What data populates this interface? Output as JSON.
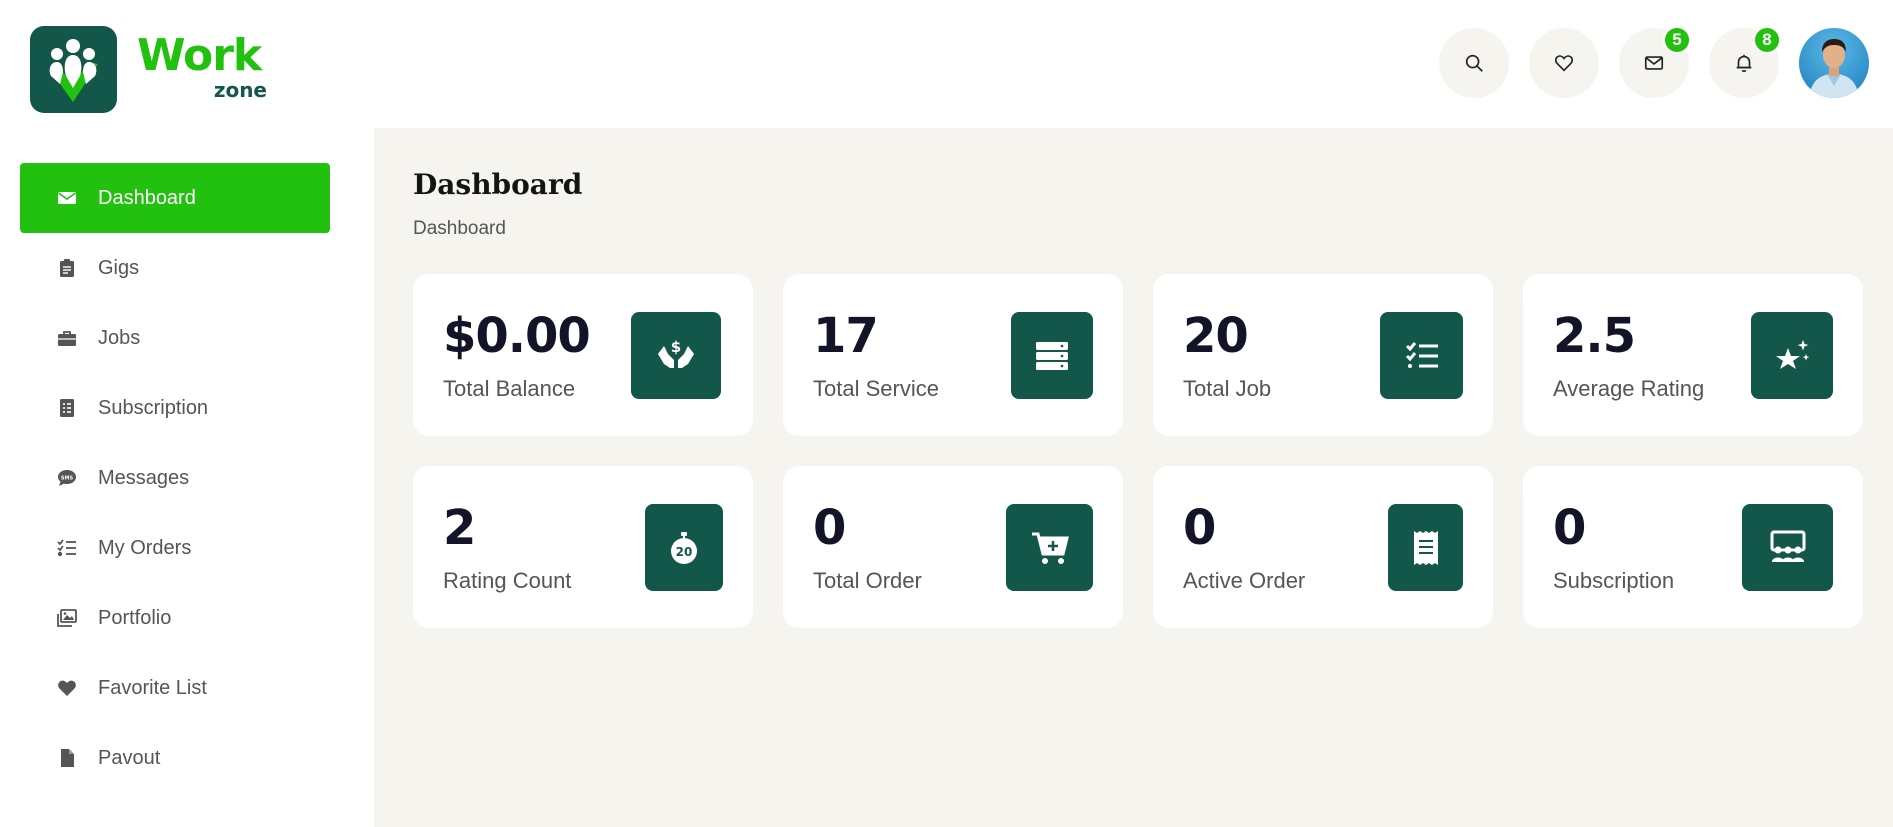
{
  "brand": {
    "word": "Work",
    "sub": "zone"
  },
  "header": {
    "badges": {
      "messages": "5",
      "notifications": "8"
    }
  },
  "sidebar": {
    "items": [
      {
        "label": "Dashboard",
        "icon": "envelope-icon",
        "active": true
      },
      {
        "label": "Gigs",
        "icon": "clipboard-icon"
      },
      {
        "label": "Jobs",
        "icon": "briefcase-icon"
      },
      {
        "label": "Subscription",
        "icon": "list-document-icon"
      },
      {
        "label": "Messages",
        "icon": "sms-bubble-icon"
      },
      {
        "label": "My Orders",
        "icon": "checklist-icon"
      },
      {
        "label": "Portfolio",
        "icon": "images-icon"
      },
      {
        "label": "Favorite List",
        "icon": "heart-icon"
      },
      {
        "label": "Pavout",
        "icon": "file-icon"
      }
    ]
  },
  "main": {
    "title": "Dashboard",
    "breadcrumb": "Dashboard",
    "stats": [
      {
        "value": "$0.00",
        "label": "Total Balance",
        "icon": "hands-dollar-icon"
      },
      {
        "value": "17",
        "label": "Total Service",
        "icon": "server-icon"
      },
      {
        "value": "20",
        "label": "Total Job",
        "icon": "list-check-icon"
      },
      {
        "value": "2.5",
        "label": "Average Rating",
        "icon": "star-sparkle-icon"
      },
      {
        "value": "2",
        "label": "Rating Count",
        "icon": "stopwatch-20-icon"
      },
      {
        "value": "0",
        "label": "Total Order",
        "icon": "cart-plus-icon"
      },
      {
        "value": "0",
        "label": "Active Order",
        "icon": "receipt-icon"
      },
      {
        "value": "0",
        "label": "Subscription",
        "icon": "people-group-icon"
      }
    ]
  },
  "colors": {
    "accent": "#22c00f",
    "brand_dark": "#13574a",
    "main_bg": "#f5f4ef"
  }
}
